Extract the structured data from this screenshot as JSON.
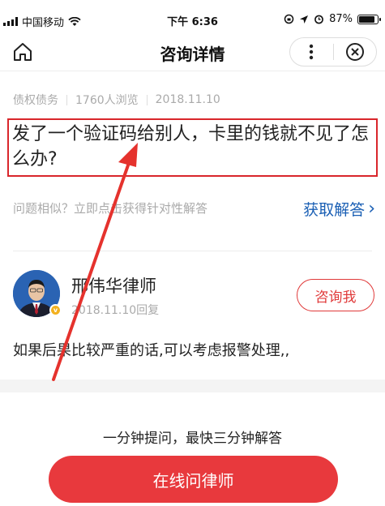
{
  "status_bar": {
    "carrier": "中国移动",
    "time": "下午 6:36",
    "battery_pct_text": "87%",
    "battery_level": 0.87
  },
  "nav": {
    "title": "咨询详情",
    "more_icon": "more-dots-icon",
    "close_icon": "close-circle-icon",
    "home_icon": "home-icon"
  },
  "meta": {
    "category": "债权债务",
    "views": "1760人浏览",
    "date": "2018.11.10"
  },
  "question": {
    "text": "发了一个验证码给别人，卡里的钱就不见了怎么办?"
  },
  "similar": {
    "prompt": "问题相似？立即点击获得针对性解答",
    "action": "获取解答",
    "chevron": "›"
  },
  "lawyer": {
    "name": "邢伟华律师",
    "reply_time": "2018.11.10回复",
    "consult_label": "咨询我",
    "answer": "如果后果比较严重的话,可以考虑报警处理,,"
  },
  "footer": {
    "slogan": "一分钟提问，最快三分钟解答",
    "button_label": "在线问律师"
  },
  "colors": {
    "accent_red": "#e8393d",
    "link_blue": "#1a5fb4",
    "highlight_red": "#d9262b"
  }
}
